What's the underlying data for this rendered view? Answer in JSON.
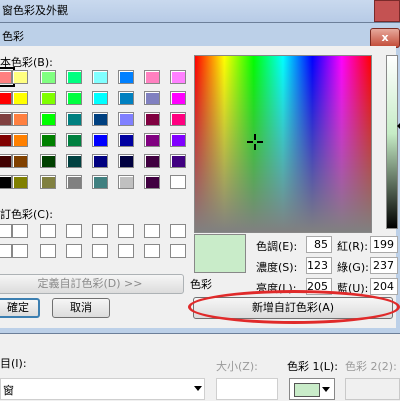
{
  "background_window": {
    "title": "窗色彩及外觀",
    "item_label": "目(I):",
    "item_value": "窗",
    "size_label": "大小(Z):",
    "color1_label": "色彩 1(L):",
    "color2_label": "色彩 2(2):"
  },
  "dialog": {
    "title": "色彩",
    "close_label": "x",
    "basic_colors_label": "本色彩(B):",
    "custom_colors_label": "訂色彩(C):",
    "define_custom_button": "定義自訂色彩(D) >>",
    "ok_button": "確定",
    "cancel_button": "取消",
    "add_to_custom_button": "新增自訂色彩(A)",
    "color_solid_label": "色彩",
    "hue_label": "色調(E):",
    "hue_value": "85",
    "sat_label": "濃度(S):",
    "sat_value": "123",
    "lum_label": "亮度(L):",
    "lum_value": "205",
    "red_label": "紅(R):",
    "red_value": "199",
    "green_label": "綠(G):",
    "green_value": "237",
    "blue_label": "藍(U):",
    "blue_value": "204"
  },
  "colors": {
    "preview": "#c9ecc9",
    "highlight_ellipse": "#e02a2a",
    "basic_grid": [
      [
        "#ff8080",
        "#ffff80",
        "#80ff80",
        "#00ff80",
        "#80ffff",
        "#0080ff",
        "#ff80c0",
        "#ff80ff"
      ],
      [
        "#ff0000",
        "#ffff00",
        "#80ff00",
        "#00ff40",
        "#00ffff",
        "#0080c0",
        "#8080c0",
        "#ff00ff"
      ],
      [
        "#804040",
        "#ff8040",
        "#00ff00",
        "#008080",
        "#004080",
        "#8080ff",
        "#800040",
        "#ff0080"
      ],
      [
        "#800000",
        "#ff8000",
        "#008000",
        "#008040",
        "#0000ff",
        "#0000a0",
        "#800080",
        "#8000ff"
      ],
      [
        "#400000",
        "#804000",
        "#004000",
        "#004040",
        "#000080",
        "#000040",
        "#400040",
        "#400080"
      ],
      [
        "#000000",
        "#808000",
        "#808040",
        "#808080",
        "#408080",
        "#c0c0c0",
        "#400040",
        "#ffffff"
      ]
    ]
  }
}
